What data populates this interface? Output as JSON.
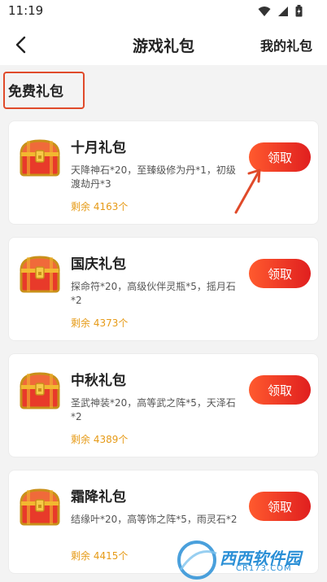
{
  "status_bar": {
    "time": "11:19"
  },
  "nav": {
    "title": "游戏礼包",
    "right_label": "我的礼包"
  },
  "section": {
    "title": "免费礼包"
  },
  "gifts": [
    {
      "name": "十月礼包",
      "desc": "天降神石*20，至臻级修为丹*1，初级渡劫丹*3",
      "remain": "剩余 4163个",
      "button": "领取"
    },
    {
      "name": "国庆礼包",
      "desc": "探命符*20，高级伙伴灵瓶*5，摇月石*2",
      "remain": "剩余 4373个",
      "button": "领取"
    },
    {
      "name": "中秋礼包",
      "desc": "圣武神装*20，高等武之阵*5，天泽石*2",
      "remain": "剩余 4389个",
      "button": "领取"
    },
    {
      "name": "霜降礼包",
      "desc": "结缘叶*20，高等饰之阵*5，雨灵石*2",
      "remain": "剩余 4415个",
      "button": "领取"
    }
  ],
  "watermark": {
    "name": "西西软件园",
    "url": "CR173.COM"
  },
  "colors": {
    "accent": "#e01f1f",
    "remain": "#e69a16",
    "highlight_border": "#e04a2a"
  }
}
